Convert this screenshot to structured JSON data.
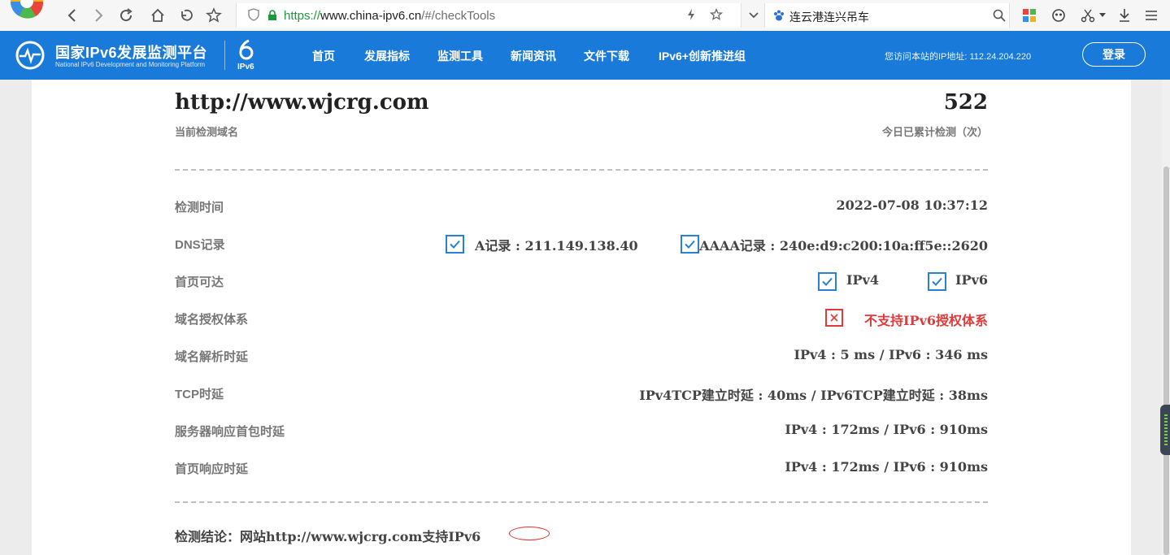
{
  "browser": {
    "url_protocol": "https://",
    "url_host": "www.china-ipv6.cn",
    "url_path": "/#/checkTools",
    "search_query": "连云港连兴吊车"
  },
  "site": {
    "title": "国家IPv6发展监测平台",
    "subtitle": "National IPv6 Development and Monitoring Platform",
    "ipv6_mark": "IPv6",
    "nav": [
      "首页",
      "发展指标",
      "监测工具",
      "新闻资讯",
      "文件下载",
      "IPv6+创新推进组"
    ],
    "visitor_ip": "您访问本站的IP地址: 112.24.204.220",
    "login_label": "登录",
    "brand_color": "#1a7ad9"
  },
  "result": {
    "domain": "http://www.wjcrg.com",
    "domain_label": "当前检测域名",
    "count": "522",
    "count_label": "今日已累计检测（次）",
    "rows": {
      "check_time": {
        "label": "检测时间",
        "value": "2022-07-08 10:37:12"
      },
      "dns": {
        "label": "DNS记录",
        "a_record": "A记录 : 211.149.138.40",
        "aaaa_record": "AAAA记录 : 240e:d9:c200:10a:ff5e::2620"
      },
      "reachable": {
        "label": "首页可达",
        "ipv4": "IPv4",
        "ipv6": "IPv6"
      },
      "auth": {
        "label": "域名授权体系",
        "value": "不支持IPv6授权体系"
      },
      "dns_delay": {
        "label": "域名解析时延",
        "value": "IPv4 : 5 ms / IPv6 : 346 ms"
      },
      "tcp_delay": {
        "label": "TCP时延",
        "value": "IPv4TCP建立时延 : 40ms / IPv6TCP建立时延 : 38ms"
      },
      "first_packet": {
        "label": "服务器响应首包时延",
        "value": "IPv4 : 172ms / IPv6 : 910ms"
      },
      "home_response": {
        "label": "首页响应时延",
        "value": "IPv4 : 172ms / IPv6 : 910ms"
      }
    },
    "conclusion": "检测结论：网站http://www.wjcrg.com支持IPv6"
  }
}
